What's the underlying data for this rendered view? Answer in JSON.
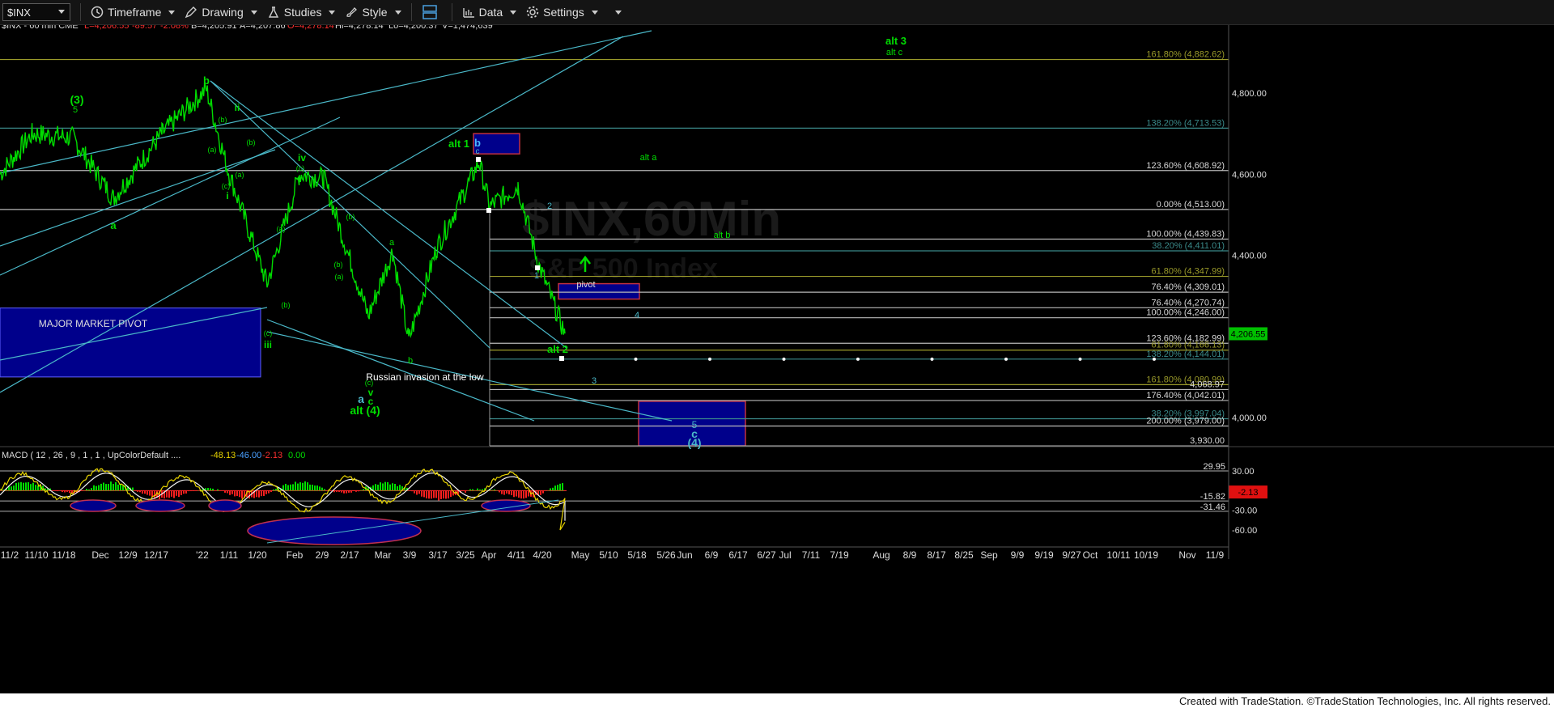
{
  "toolbar": {
    "symbol": "$INX",
    "buttons": [
      {
        "label": "Timeframe",
        "icon": "clock-icon"
      },
      {
        "label": "Drawing",
        "icon": "pencil-icon"
      },
      {
        "label": "Studies",
        "icon": "flask-icon"
      },
      {
        "label": "Style",
        "icon": "brush-icon"
      },
      {
        "label": "Data",
        "icon": "bars-icon"
      },
      {
        "label": "Settings",
        "icon": "gear-icon"
      }
    ]
  },
  "header": {
    "instrument": "$INX - 60 min  CME",
    "last": "L=4,206.55",
    "change": "-89.57",
    "pct": "-2.08%",
    "bid": "B=4,205.91",
    "ask": "A=4,207.86",
    "open": "O=4,278.14",
    "high": "Hi=4,278.14",
    "low": "Lo=4,200.37",
    "volume": "V=1,474,639"
  },
  "watermark": {
    "line1": "$INX,60Min",
    "line2": "S&P 500 Index"
  },
  "footer": "Created with TradeStation. ©TradeStation Technologies, Inc. All rights reserved.",
  "colors": {
    "background": "#000000",
    "price": "#00dd00",
    "trend": "#4ab8c8",
    "fib": "#c0c0c0",
    "fib_olive": "#9a9a2a",
    "fib_teal": "#3a8a8a",
    "box": "#00008b",
    "last_price": "#00c000",
    "macd_neg": "#ff1e1e"
  },
  "chart_data": [
    {
      "type": "line",
      "title": "$INX - 60 min",
      "series": [
        {
          "name": "$INX",
          "x": [
            "11/2",
            "11/10",
            "11/18",
            "Dec",
            "12/9",
            "12/17",
            "'22",
            "1/11",
            "1/20",
            "Feb",
            "2/9",
            "2/17",
            "Mar",
            "3/9",
            "3/17",
            "3/25",
            "Apr",
            "4/11",
            "4/20"
          ],
          "values": [
            4630,
            4690,
            4700,
            4560,
            4680,
            4690,
            4790,
            4620,
            4330,
            4540,
            4560,
            4300,
            4400,
            4200,
            4450,
            4630,
            4560,
            4420,
            4207
          ]
        }
      ],
      "x_ticks": [
        "11/2",
        "11/10",
        "11/18",
        "Dec",
        "12/9",
        "12/17",
        "'22",
        "1/11",
        "1/20",
        "Feb",
        "2/9",
        "2/17",
        "Mar",
        "3/9",
        "3/17",
        "3/25",
        "Apr",
        "4/11",
        "4/20",
        "May",
        "5/10",
        "5/18",
        "5/26",
        "Jun",
        "6/9",
        "6/17",
        "6/27",
        "Jul",
        "7/11",
        "7/19",
        "Aug",
        "8/9",
        "8/17",
        "8/25",
        "Sep",
        "9/9",
        "9/19",
        "9/27",
        "Oct",
        "10/11",
        "10/19",
        "Nov",
        "11/9"
      ],
      "y_ticks": [
        "4,800.00",
        "4,600.00",
        "4,400.00",
        "4,000.00"
      ],
      "last_value": "4,206.55",
      "ylim": [
        3930,
        4900
      ],
      "fib_levels": [
        {
          "value": 4882.62,
          "label": "161.80% (4,882.62)",
          "color": "olive"
        },
        {
          "value": 4713.53,
          "label": "138.20% (4,713.53)",
          "color": "teal"
        },
        {
          "value": 4608.92,
          "label": "123.60% (4,608.92)",
          "color": "silver"
        },
        {
          "value": 4513.0,
          "label": "0.00% (4,513.00)",
          "color": "silver"
        },
        {
          "value": 4439.83,
          "label": "100.00% (4,439.83)",
          "color": "silver"
        },
        {
          "value": 4411.01,
          "label": "38.20% (4,411.01)",
          "color": "teal"
        },
        {
          "value": 4347.99,
          "label": "61.80% (4,347.99)",
          "color": "olive"
        },
        {
          "value": 4309.01,
          "label": "76.40% (4,309.01)",
          "color": "silver"
        },
        {
          "value": 4270.74,
          "label": "76.40% (4,270.74)",
          "color": "silver"
        },
        {
          "value": 4246.0,
          "label": "100.00% (4,246.00)",
          "color": "silver"
        },
        {
          "value": 4182.99,
          "label": "123.60% (4,182.99)",
          "color": "silver"
        },
        {
          "value": 4166.13,
          "label": "61.80% (4,166.13)",
          "color": "olive"
        },
        {
          "value": 4144.01,
          "label": "138.20% (4,144.01)",
          "color": "teal"
        },
        {
          "value": 4080.99,
          "label": "161.80% (4,080.99)",
          "color": "olive"
        },
        {
          "value": 4068.97,
          "label": "4,068.97",
          "color": "silver"
        },
        {
          "value": 4042.01,
          "label": "176.40% (4,042.01)",
          "color": "silver"
        },
        {
          "value": 3997.04,
          "label": "38.20% (3,997.04)",
          "color": "teal"
        },
        {
          "value": 3979.0,
          "label": "200.00% (3,979.00)",
          "color": "silver"
        },
        {
          "value": 3930.0,
          "label": "3,930.00",
          "color": "silver"
        }
      ],
      "annotations": [
        "alt 3",
        "alt c",
        "(3)",
        "5",
        "b",
        "ii",
        "iv",
        "alt 1",
        "c",
        "alt a",
        "2",
        "alt b",
        "1",
        "pivot",
        "4",
        "alt 2",
        "3",
        "MAJOR MARKET PIVOT",
        "iii",
        "Russian invasion at the low",
        "a",
        "v",
        "c",
        "alt (4)",
        "(c)",
        "(a)",
        "(b)",
        "i",
        "5",
        "c",
        "(4)"
      ]
    },
    {
      "type": "line",
      "title": "MACD ( 12 , 26 , 9 , 1 , 1 , UpColorDefault ....",
      "series": [
        {
          "name": "MACD",
          "value": -48.13
        },
        {
          "name": "MACDAvg",
          "value": -46.0
        },
        {
          "name": "MACDDiff",
          "value": -2.13
        },
        {
          "name": "ZeroLine",
          "value": 0.0
        }
      ],
      "readout": [
        "-48.13",
        "-46.00",
        "-2.13",
        "0.00"
      ],
      "y_ticks": [
        "30.00",
        "-30.00",
        "-60.00"
      ],
      "levels": [
        {
          "value": 29.95,
          "label": "29.95"
        },
        {
          "value": -15.82,
          "label": "-15.82"
        },
        {
          "value": -31.46,
          "label": "-31.46"
        }
      ],
      "last_value": "-2.13",
      "ylim": [
        -75,
        45
      ]
    }
  ]
}
